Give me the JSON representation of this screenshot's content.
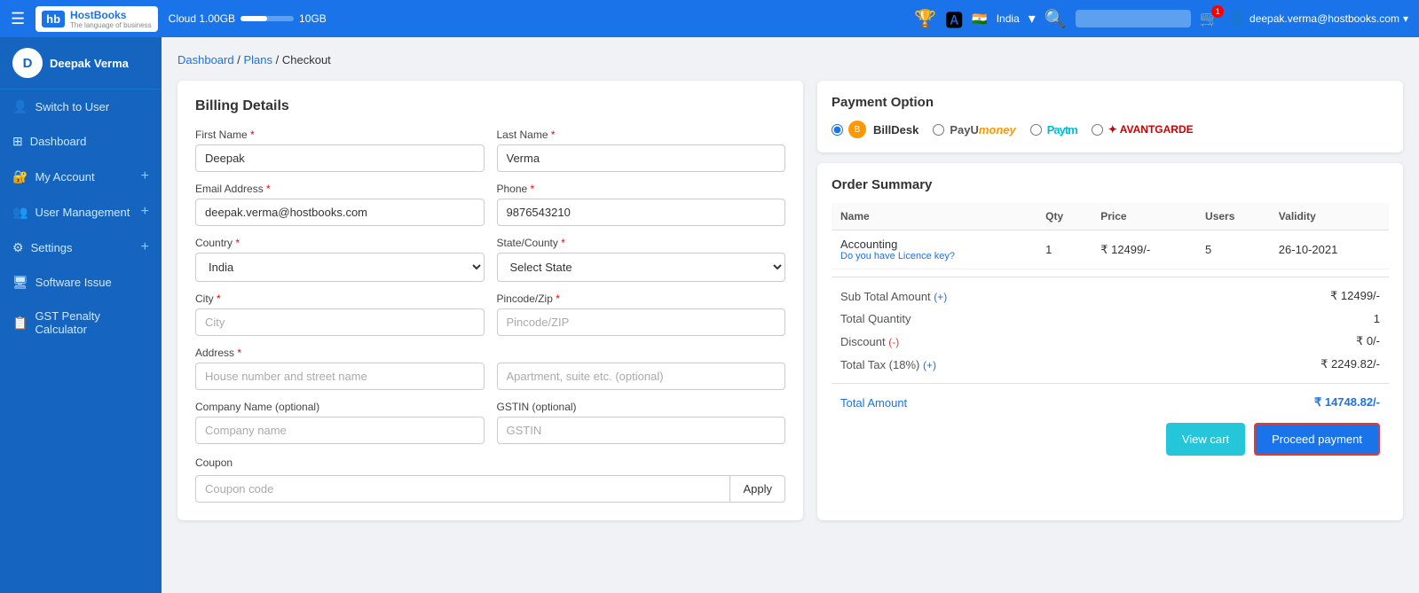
{
  "topnav": {
    "hamburger": "☰",
    "logo_main": "hb",
    "logo_brand": "HostBooks",
    "logo_tagline": "The language of business",
    "cloud_label": "Cloud 1.00GB",
    "cloud_separator": "――――――",
    "cloud_limit": "10GB",
    "search_placeholder": "",
    "cart_count": "1",
    "india_flag": "🇮🇳",
    "india_label": "India",
    "user_email": "deepak.verma@hostbooks.com",
    "dropdown_arrow": "▾"
  },
  "sidebar": {
    "username": "Deepak Verma",
    "avatar_initials": "D",
    "items": [
      {
        "id": "switch-to-user",
        "icon": "👤",
        "label": "Switch to User",
        "has_plus": false
      },
      {
        "id": "dashboard",
        "icon": "⊞",
        "label": "Dashboard",
        "has_plus": false
      },
      {
        "id": "my-account",
        "icon": "🔐",
        "label": "My Account",
        "has_plus": true
      },
      {
        "id": "user-management",
        "icon": "👥",
        "label": "User Management",
        "has_plus": true
      },
      {
        "id": "settings",
        "icon": "⚙",
        "label": "Settings",
        "has_plus": true
      },
      {
        "id": "software-issue",
        "icon": "🖥",
        "label": "Software Issue",
        "has_plus": false
      },
      {
        "id": "gst-penalty",
        "icon": "📋",
        "label": "GST Penalty Calculator",
        "has_plus": false
      }
    ]
  },
  "breadcrumb": {
    "parts": [
      "Dashboard",
      "Plans",
      "Checkout"
    ],
    "separators": [
      " / ",
      " / "
    ]
  },
  "billing": {
    "title": "Billing Details",
    "fields": {
      "first_name_label": "First Name",
      "first_name_value": "Deepak",
      "last_name_label": "Last Name",
      "last_name_value": "Verma",
      "email_label": "Email Address",
      "email_value": "deepak.verma@hostbooks.com",
      "phone_label": "Phone",
      "phone_value": "9876543210",
      "country_label": "Country",
      "country_value": "India",
      "state_label": "State/County",
      "state_placeholder": "Select State",
      "city_label": "City",
      "city_placeholder": "City",
      "pincode_label": "Pincode/Zip",
      "pincode_placeholder": "Pincode/ZIP",
      "address_label": "Address",
      "address1_placeholder": "House number and street name",
      "address2_placeholder": "Apartment, suite etc. (optional)",
      "company_label": "Company Name (optional)",
      "company_placeholder": "Company name",
      "gstin_label": "GSTIN (optional)",
      "gstin_placeholder": "GSTIN",
      "coupon_label": "Coupon",
      "coupon_placeholder": "Coupon code",
      "apply_label": "Apply"
    }
  },
  "payment_option": {
    "title": "Payment Option",
    "methods": [
      {
        "id": "billdesk",
        "label": "BillDesk",
        "selected": true
      },
      {
        "id": "payumoney",
        "label": "PayUmoney",
        "selected": false
      },
      {
        "id": "paytm",
        "label": "Paytm",
        "selected": false
      },
      {
        "id": "avantgarde",
        "label": "AVANTGARDE",
        "selected": false
      }
    ]
  },
  "order_summary": {
    "title": "Order Summary",
    "columns": [
      "Name",
      "Qty",
      "Price",
      "Users",
      "Validity"
    ],
    "rows": [
      {
        "name": "Accounting",
        "sub": "Do you have Licence key?",
        "qty": "1",
        "price": "₹ 12499/-",
        "users": "5",
        "validity": "26-10-2021"
      }
    ],
    "sub_total_label": "Sub Total Amount",
    "sub_total_plus": "(+)",
    "sub_total_value": "₹ 12499/-",
    "total_qty_label": "Total Quantity",
    "total_qty_value": "1",
    "discount_label": "Discount",
    "discount_minus": "(-)",
    "discount_value": "₹ 0/-",
    "tax_label": "Total Tax (18%)",
    "tax_plus": "(+)",
    "tax_value": "₹ 2249.82/-",
    "total_label": "Total Amount",
    "total_value": "₹ 14748.82/-",
    "view_cart_label": "View cart",
    "proceed_label": "Proceed payment"
  }
}
